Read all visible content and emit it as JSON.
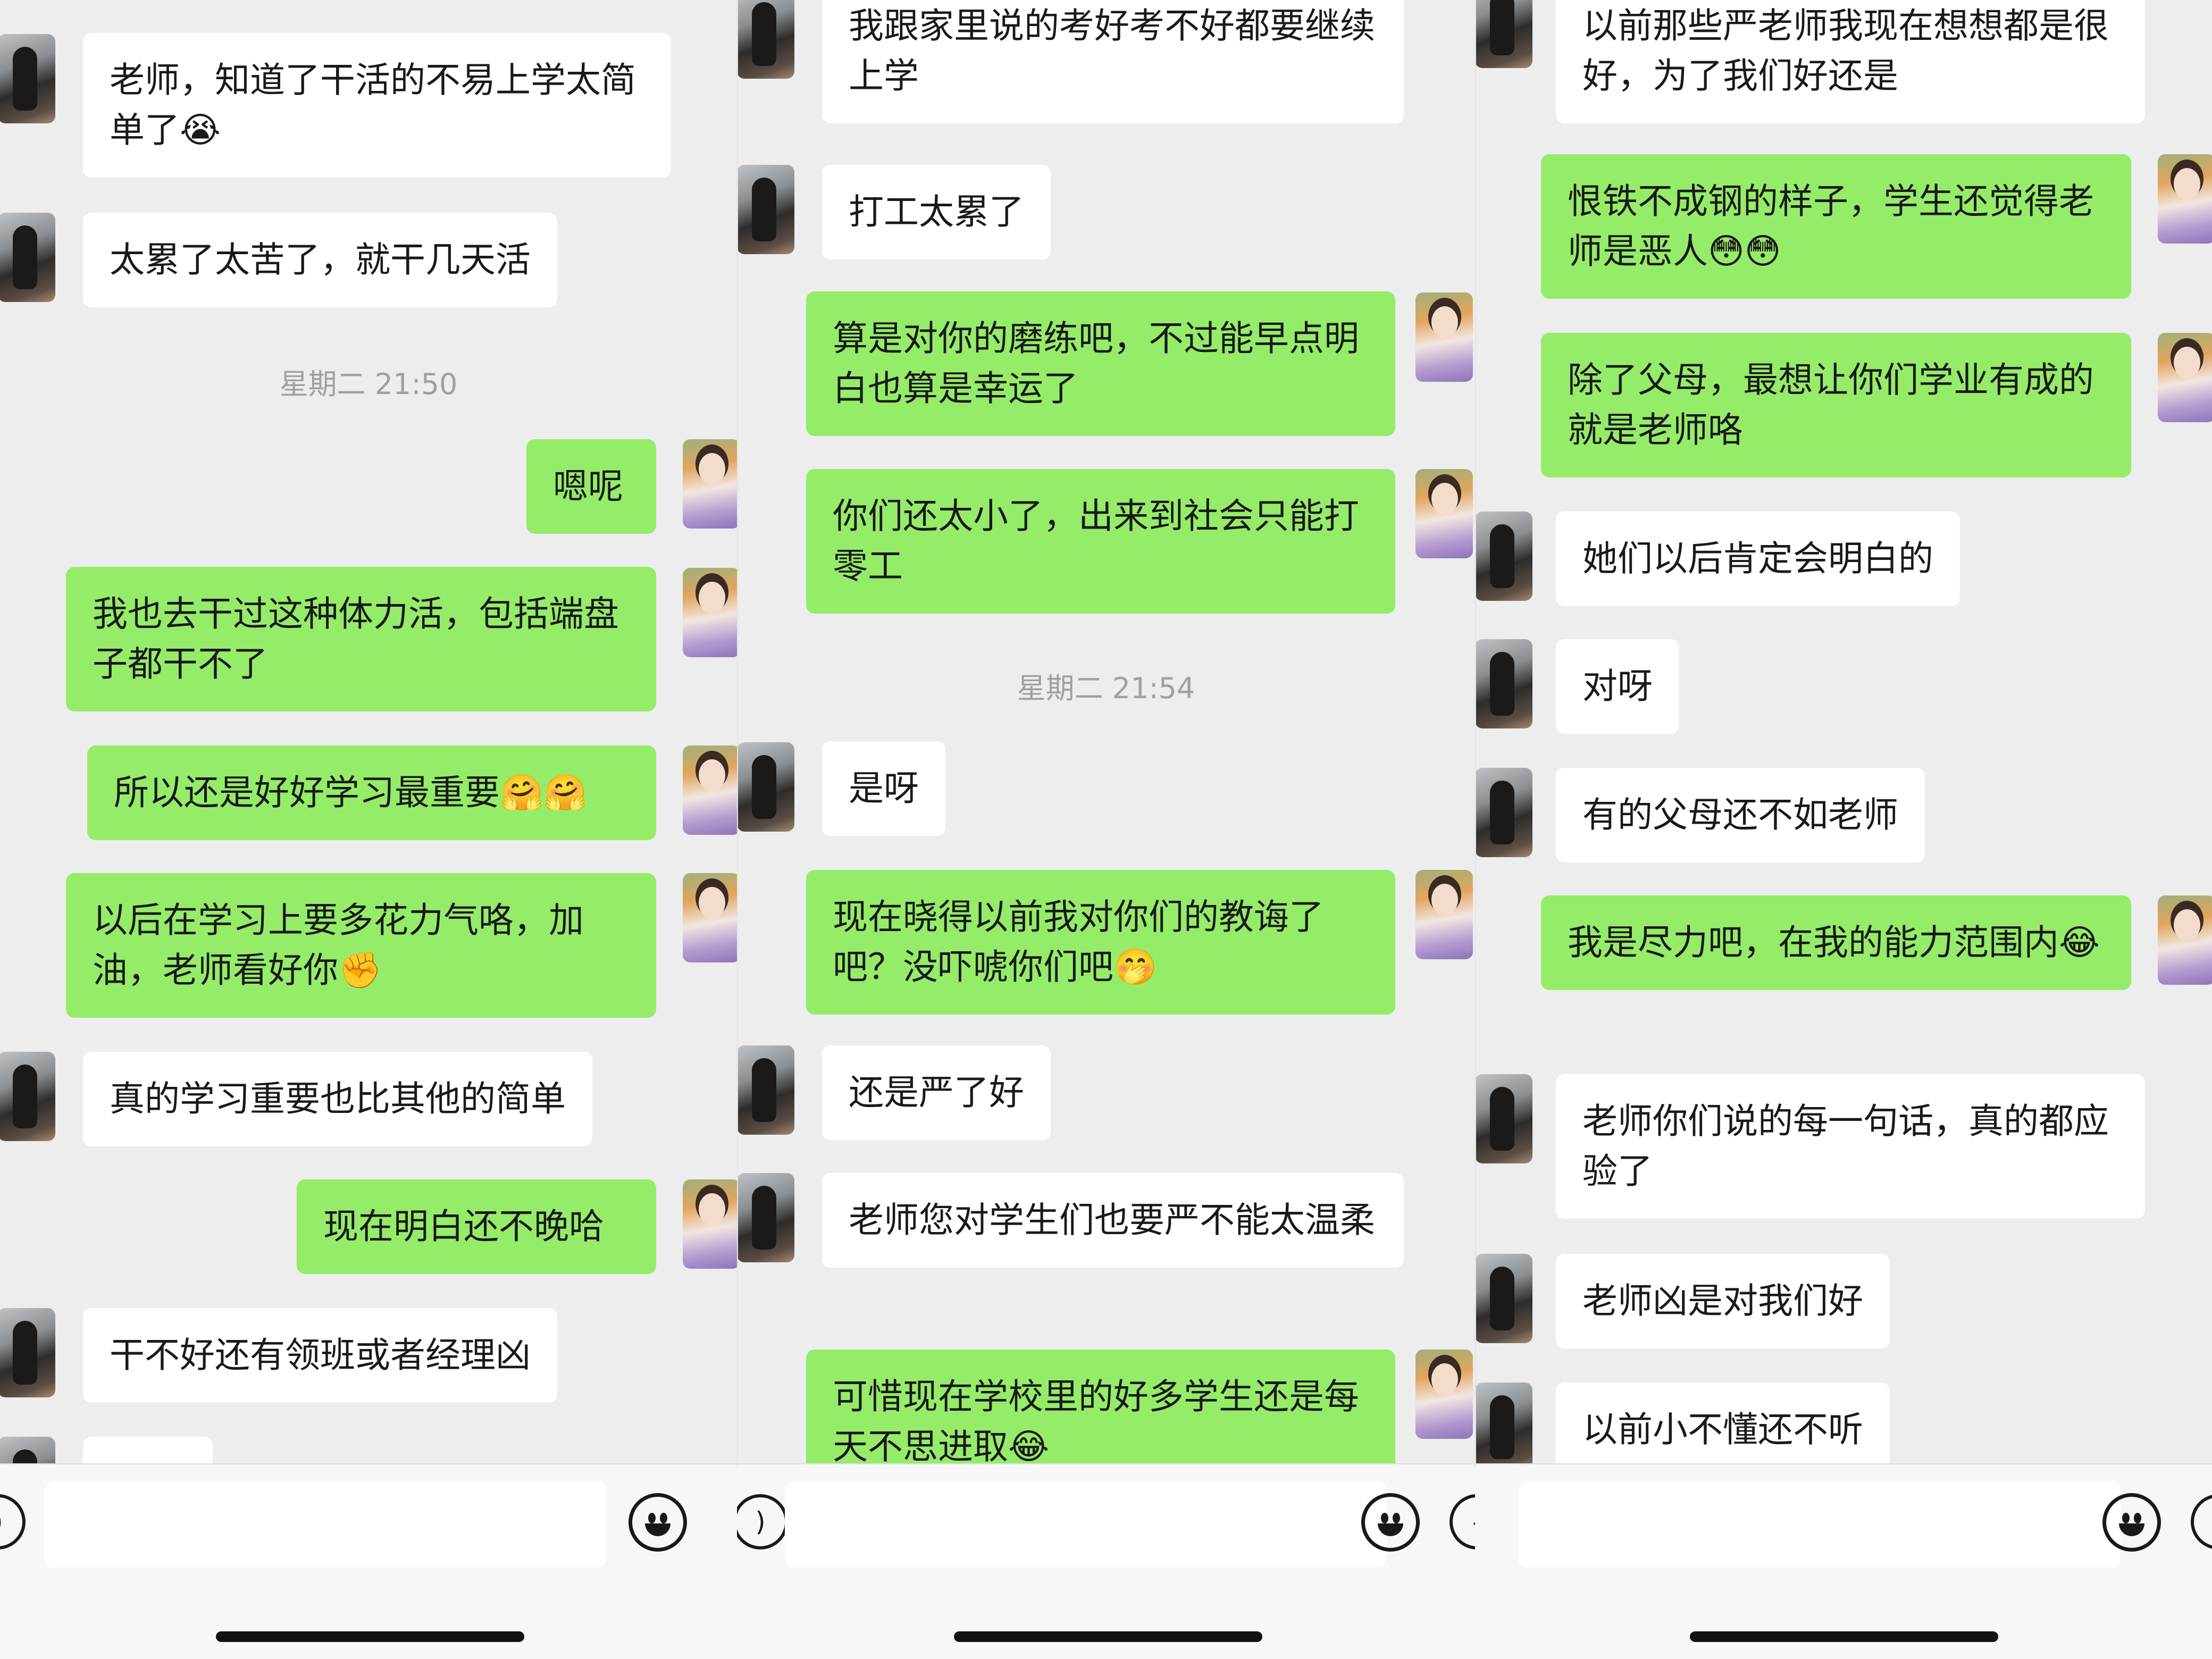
{
  "panels": [
    {
      "messages": [
        {
          "dir": "in",
          "text": "老师，知道了干活的不易上学太简单了😭"
        },
        {
          "dir": "in",
          "text": "太累了太苦了，就干几天活"
        },
        {
          "dir": "time",
          "text": "星期二 21:50"
        },
        {
          "dir": "out",
          "text": "嗯呢"
        },
        {
          "dir": "out",
          "text": "我也去干过这种体力活，包括端盘子都干不了"
        },
        {
          "dir": "out",
          "text": "所以还是好好学习最重要🤗🤗"
        },
        {
          "dir": "out",
          "text": "以后在学习上要多花力气咯，加油，老师看好你✊"
        },
        {
          "dir": "in",
          "text": "真的学习重要也比其他的简单"
        },
        {
          "dir": "out",
          "text": "现在明白还不晚哈"
        },
        {
          "dir": "in",
          "text": "干不好还有领班或者经理凶"
        }
      ]
    },
    {
      "messages": [
        {
          "dir": "in",
          "text": "我跟家里说的考好考不好都要继续上学"
        },
        {
          "dir": "in",
          "text": "打工太累了"
        },
        {
          "dir": "out",
          "text": "算是对你的磨练吧，不过能早点明白也算是幸运了"
        },
        {
          "dir": "out",
          "text": "你们还太小了，出来到社会只能打零工"
        },
        {
          "dir": "time",
          "text": "星期二 21:54"
        },
        {
          "dir": "in",
          "text": "是呀"
        },
        {
          "dir": "out",
          "text": "现在晓得以前我对你们的教诲了吧？没吓唬你们吧🤭"
        },
        {
          "dir": "in",
          "text": "还是严了好"
        },
        {
          "dir": "in",
          "text": "老师您对学生们也要严不能太温柔"
        },
        {
          "dir": "out",
          "text": "可惜现在学校里的好多学生还是每天不思进取😂"
        }
      ]
    },
    {
      "messages": [
        {
          "dir": "in",
          "text": "以前那些严老师我现在想想都是很好，为了我们好还是"
        },
        {
          "dir": "out",
          "text": "恨铁不成钢的样子，学生还觉得老师是恶人😳😳"
        },
        {
          "dir": "out",
          "text": "除了父母，最想让你们学业有成的就是老师咯"
        },
        {
          "dir": "in",
          "text": "她们以后肯定会明白的"
        },
        {
          "dir": "in",
          "text": "对呀"
        },
        {
          "dir": "in",
          "text": "有的父母还不如老师"
        },
        {
          "dir": "out",
          "text": "我是尽力吧，在我的能力范围内😂"
        },
        {
          "dir": "in",
          "text": "老师你们说的每一句话，真的都应验了"
        },
        {
          "dir": "in",
          "text": "老师凶是对我们好"
        },
        {
          "dir": "in",
          "text": "以前小不懂还不听"
        }
      ]
    }
  ],
  "input_bar": {
    "voice_icon": "voice-icon",
    "emoji_icon": "emoji-icon",
    "placeholder": ""
  }
}
